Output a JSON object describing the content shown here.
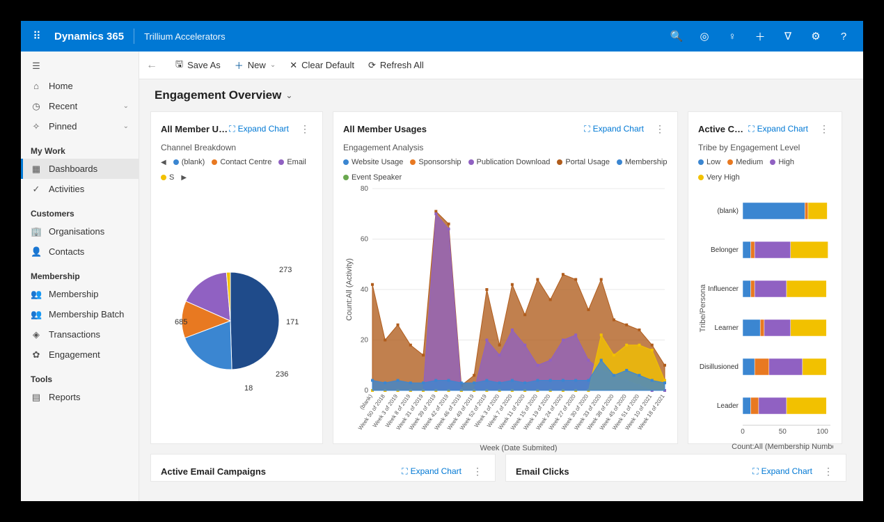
{
  "header": {
    "brand": "Dynamics 365",
    "sub": "Trillium Accelerators"
  },
  "sidebar": {
    "top": [
      {
        "label": "Home",
        "icon": "⌂"
      },
      {
        "label": "Recent",
        "icon": "◷",
        "chev": true
      },
      {
        "label": "Pinned",
        "icon": "✧",
        "chev": true
      }
    ],
    "sections": [
      {
        "title": "My Work",
        "items": [
          {
            "label": "Dashboards",
            "icon": "▦",
            "active": true
          },
          {
            "label": "Activities",
            "icon": "✓"
          }
        ]
      },
      {
        "title": "Customers",
        "items": [
          {
            "label": "Organisations",
            "icon": "🏢"
          },
          {
            "label": "Contacts",
            "icon": "👤"
          }
        ]
      },
      {
        "title": "Membership",
        "items": [
          {
            "label": "Membership",
            "icon": "👥"
          },
          {
            "label": "Membership Batch",
            "icon": "👥"
          },
          {
            "label": "Transactions",
            "icon": "◈"
          },
          {
            "label": "Engagement",
            "icon": "✿"
          }
        ]
      },
      {
        "title": "Tools",
        "items": [
          {
            "label": "Reports",
            "icon": "▤"
          }
        ]
      }
    ]
  },
  "cmdbar": {
    "saveAs": "Save As",
    "new": "New",
    "clear": "Clear Default",
    "refresh": "Refresh All"
  },
  "page": {
    "title": "Engagement Overview"
  },
  "cards": {
    "pie": {
      "title": "All Member Usa...",
      "expand": "Expand Chart",
      "sub": "Channel Breakdown"
    },
    "area": {
      "title": "All Member Usages",
      "expand": "Expand Chart",
      "sub": "Engagement Analysis",
      "ylabel": "Count:All (Activity)",
      "xlabel": "Week (Date Submited)"
    },
    "bars": {
      "title": "Active Contacts",
      "expand": "Expand Chart",
      "sub": "Tribe by Engagement Level",
      "ylabel": "Tribe/Persona",
      "xlabel": "Count:All (Membership Number)"
    },
    "email1": {
      "title": "Active Email Campaigns",
      "expand": "Expand Chart"
    },
    "email2": {
      "title": "Email Clicks",
      "expand": "Expand Chart"
    }
  },
  "chart_data": {
    "pie": {
      "type": "pie",
      "title": "Channel Breakdown",
      "legend": [
        "(blank)",
        "Contact Centre",
        "Email",
        "S"
      ],
      "colors": [
        "#3b86d1",
        "#e87921",
        "#9061c2",
        "#f2c100",
        "#1f4b8a"
      ],
      "slices": [
        {
          "label": "(blank)",
          "value": 685,
          "color": "#1f4b8a"
        },
        {
          "label": "273",
          "value": 273,
          "color": "#3b86d1"
        },
        {
          "label": "171",
          "value": 171,
          "color": "#e87921"
        },
        {
          "label": "236",
          "value": 236,
          "color": "#9061c2"
        },
        {
          "label": "18",
          "value": 18,
          "color": "#f2c100"
        }
      ]
    },
    "area": {
      "type": "area",
      "legend": [
        {
          "name": "Website Usage",
          "color": "#3b86d1"
        },
        {
          "name": "Sponsorship",
          "color": "#e87921"
        },
        {
          "name": "Publication Download",
          "color": "#9061c2"
        },
        {
          "name": "Portal Usage",
          "color": "#b05c1c"
        },
        {
          "name": "Membership",
          "color": "#3b86d1"
        },
        {
          "name": "Event Speaker",
          "color": "#6aa84f"
        }
      ],
      "yticks": [
        0,
        20,
        40,
        60,
        80
      ],
      "categories": [
        "(blank)",
        "Week 50 of 2018",
        "Week 3 of 2019",
        "Week 8 of 2019",
        "Week 31 of 2019",
        "Week 39 of 2019",
        "Week 42 of 2019",
        "Week 46 of 2019",
        "Week 49 of 2019",
        "Week 52 of 2019",
        "Week 3 of 2020",
        "Week 7 of 2020",
        "Week 11 of 2020",
        "Week 15 of 2020",
        "Week 19 of 2020",
        "Week 24 of 2020",
        "Week 27 of 2020",
        "Week 30 of 2020",
        "Week 33 of 2020",
        "Week 38 of 2020",
        "Week 45 of 2020",
        "Week 51 of 2020",
        "Week 10 of 2021",
        "Week 18 of 2021"
      ],
      "series": [
        {
          "name": "Portal Usage",
          "color": "#b05c1c",
          "values": [
            42,
            20,
            26,
            18,
            14,
            71,
            66,
            2,
            6,
            40,
            18,
            42,
            30,
            44,
            36,
            46,
            44,
            32,
            44,
            28,
            26,
            24,
            18,
            10
          ]
        },
        {
          "name": "Publication Download",
          "color": "#9061c2",
          "values": [
            0,
            0,
            0,
            0,
            0,
            70,
            64,
            0,
            0,
            20,
            14,
            24,
            18,
            10,
            12,
            20,
            22,
            12,
            8,
            6,
            4,
            2,
            0,
            0
          ]
        },
        {
          "name": "Event Speaker",
          "color": "#f2c100",
          "values": [
            0,
            0,
            0,
            0,
            0,
            0,
            0,
            0,
            0,
            0,
            0,
            0,
            0,
            0,
            0,
            0,
            0,
            0,
            22,
            14,
            18,
            18,
            16,
            4
          ]
        },
        {
          "name": "Website Usage",
          "color": "#3b86d1",
          "values": [
            4,
            3,
            4,
            3,
            3,
            4,
            4,
            3,
            3,
            4,
            3,
            4,
            3,
            4,
            4,
            4,
            4,
            4,
            12,
            6,
            8,
            6,
            4,
            3
          ]
        }
      ]
    },
    "bars": {
      "type": "stacked-bar-horizontal",
      "legend": [
        {
          "name": "Low",
          "color": "#3b86d1"
        },
        {
          "name": "Medium",
          "color": "#e87921"
        },
        {
          "name": "High",
          "color": "#9061c2"
        },
        {
          "name": "Very High",
          "color": "#f2c100"
        }
      ],
      "xticks": [
        0,
        50,
        100
      ],
      "categories": [
        "(blank)",
        "Belonger",
        "Influencer",
        "Learner",
        "Disillusioned",
        "Leader"
      ],
      "series": [
        {
          "name": "Low",
          "values": [
            78,
            10,
            10,
            22,
            15,
            10
          ]
        },
        {
          "name": "Medium",
          "values": [
            4,
            5,
            5,
            5,
            18,
            10
          ]
        },
        {
          "name": "High",
          "values": [
            0,
            45,
            40,
            33,
            42,
            35
          ]
        },
        {
          "name": "Very High",
          "values": [
            24,
            47,
            50,
            45,
            30,
            50
          ]
        }
      ]
    }
  }
}
